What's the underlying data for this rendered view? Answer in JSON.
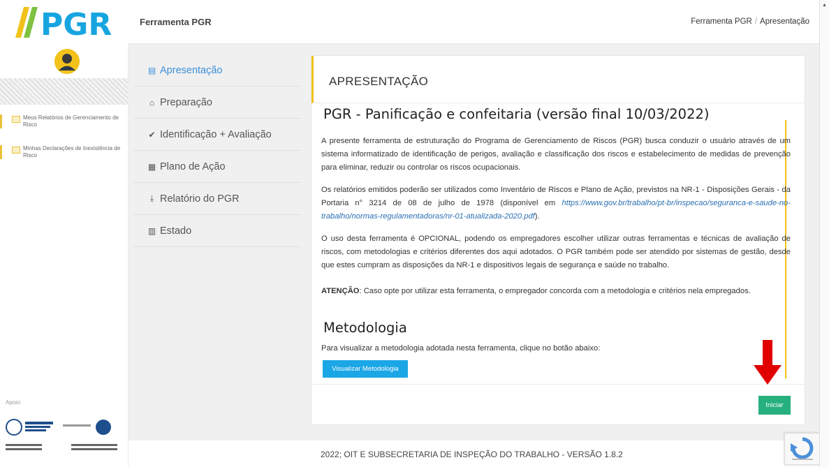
{
  "header": {
    "logo_text": "PGR",
    "app_title": "Ferramenta PGR",
    "breadcrumb": [
      "Ferramenta PGR",
      "Apresentação"
    ]
  },
  "sidebar": {
    "links": [
      {
        "label": "Meus Relatórios de Gerenciamento de Risco"
      },
      {
        "label": "Minhas Declarações de Inexistência de Risco"
      }
    ],
    "apoio": "Apoio:"
  },
  "menu": [
    {
      "label": "Apresentação",
      "icon": "document-icon",
      "glyph": "▤",
      "active": true
    },
    {
      "label": "Preparação",
      "icon": "home-icon",
      "glyph": "⌂"
    },
    {
      "label": "Identificação + Avaliação",
      "icon": "check-circle-icon",
      "glyph": "✔"
    },
    {
      "label": "Plano de Ação",
      "icon": "calendar-icon",
      "glyph": "▦"
    },
    {
      "label": "Relatório do PGR",
      "icon": "download-icon",
      "glyph": "⤓"
    },
    {
      "label": "Estado",
      "icon": "bar-chart-icon",
      "glyph": "▥"
    }
  ],
  "card": {
    "heading": "APRESENTAÇÃO",
    "subtitle": "PGR - Panificação e confeitaria (versão final 10/03/2022)",
    "p1": "A presente ferramenta de estruturação do Programa de Gerenciamento de Riscos (PGR) busca conduzir o usuário através de um sistema informatizado de identificação de perigos, avaliação e classificação dos riscos e estabelecimento de medidas de prevenção para eliminar, reduzir ou controlar os riscos ocupacionais.",
    "p2_text": "Os relatórios emitidos poderão ser utilizados como Inventário de Riscos e Plano de Ação, previstos na NR-1 - Disposições Gerais - da Portaria n° 3214 de 08 de julho de 1978 (disponível em",
    "p2_link": "https://www.gov.br/trabalho/pt-br/inspecao/seguranca-e-saude-no-trabalho/normas-regulamentadoras/nr-01-atualizada-2020.pdf",
    "p2_end": ").",
    "p3": "O uso desta ferramenta é OPCIONAL, podendo os empregadores escolher utilizar outras ferramentas e técnicas de avaliação de riscos, com metodologias e critérios diferentes dos aqui adotados. O PGR também pode ser atendido por sistemas de gestão, desde que estes cumpram as disposições da NR-1 e dispositivos legais de segurança e saúde no trabalho.",
    "p4_bold": "ATENÇÃO",
    "p4_text": ": Caso opte por utilizar esta ferramenta, o empregador concorda com a metodologia e critérios nela empregados.",
    "metodologia_title": "Metodologia",
    "metodologia_text": "Para visualizar a metodologia adotada nesta ferramenta, clique no botão abaixo:",
    "btn_metodologia": "Visualizar Metodologia",
    "btn_iniciar": "Iniciar"
  },
  "footer": {
    "text": "2022; OIT E SUBSECRETARIA DE INSPEÇÃO DO TRABALHO - VERSÃO 1.8.2"
  },
  "colors": {
    "accent_yellow": "#f2c21b",
    "link_blue": "#3b8fd6",
    "button_blue": "#1ba6e6",
    "button_green": "#26b07e",
    "arrow_red": "#e00000"
  }
}
